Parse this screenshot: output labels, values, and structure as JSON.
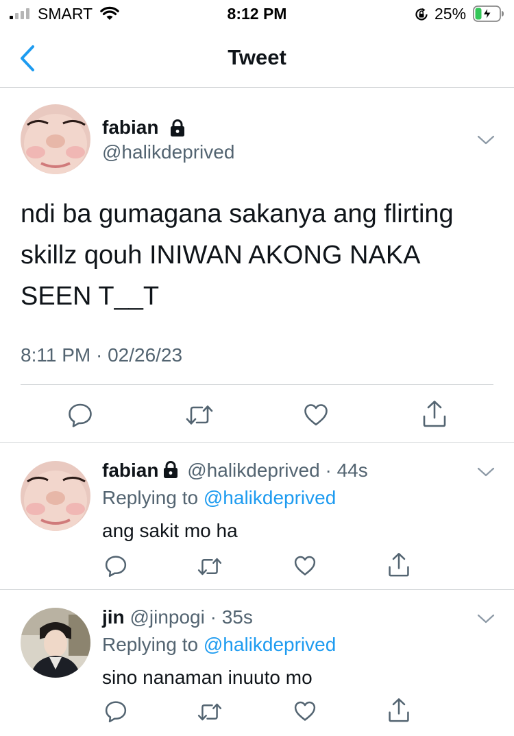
{
  "status_bar": {
    "carrier": "SMART",
    "time": "8:12 PM",
    "battery_percent": "25%",
    "icons": [
      "signal-icon",
      "wifi-icon",
      "orientation-lock-icon",
      "battery-charging-icon"
    ]
  },
  "nav": {
    "title": "Tweet",
    "back_icon": "chevron-left-icon"
  },
  "main_tweet": {
    "author_name": "fabian",
    "author_handle": "@halikdeprived",
    "protected": true,
    "text": "ndi ba gumagana sakanya ang flirting skillz qouh INIWAN AKONG NAKA SEEN T__T",
    "timestamp": "8:11 PM · 02/26/23",
    "actions": [
      "reply-icon",
      "retweet-icon",
      "like-icon",
      "share-icon"
    ]
  },
  "replies": [
    {
      "author_name": "fabian",
      "author_handle": "@halikdeprived",
      "protected": true,
      "separator": "·",
      "age": "44s",
      "replying_prefix": "Replying to",
      "replying_to": "@halikdeprived",
      "text": "ang sakit mo ha"
    },
    {
      "author_name": "jin",
      "author_handle": "@jinpogi",
      "protected": false,
      "separator": "·",
      "age": "35s",
      "replying_prefix": "Replying to",
      "replying_to": "@halikdeprived",
      "text": "sino nanaman inuuto mo"
    }
  ],
  "colors": {
    "accent": "#1d9bf0",
    "text_primary": "#0f1419",
    "text_secondary": "#536471",
    "divider": "#d6d9db",
    "icon": "#536471"
  }
}
